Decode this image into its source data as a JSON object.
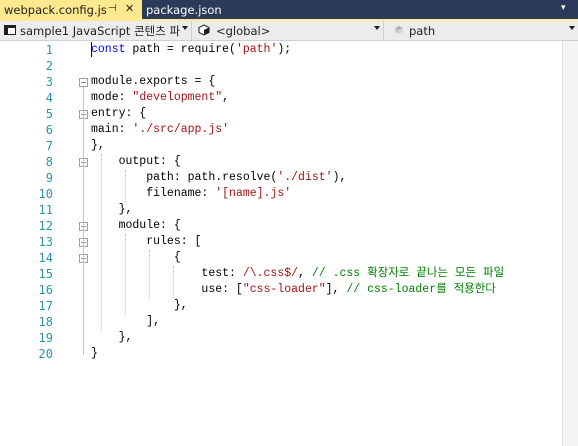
{
  "tabs": {
    "active": {
      "title": "webpack.config.js",
      "pin_glyph": "⊣",
      "close_glyph": "✕"
    },
    "inactive": {
      "title": "package.json"
    },
    "overflow_glyph": "▾"
  },
  "navbar": {
    "project": "sample1 JavaScript 콘텐츠 파",
    "scope": "<global>",
    "member": "path"
  },
  "colors": {
    "tab_active": "#ffe98f",
    "tabbar_bg": "#2b3a5a",
    "keyword": "#0000ff",
    "string": "#a31515",
    "comment": "#008000",
    "line_number": "#2b91af"
  },
  "editor": {
    "line_numbers": [
      "1",
      "2",
      "3",
      "4",
      "5",
      "6",
      "7",
      "8",
      "9",
      "10",
      "11",
      "12",
      "13",
      "14",
      "15",
      "16",
      "17",
      "18",
      "19",
      "20"
    ],
    "lines": [
      {
        "seg": [
          [
            "k",
            "const"
          ],
          [
            "t",
            " path = require("
          ],
          [
            "s",
            "'path'"
          ],
          [
            "t",
            ");"
          ]
        ]
      },
      {
        "seg": []
      },
      {
        "seg": [
          [
            "t",
            "module.exports = {"
          ]
        ]
      },
      {
        "seg": [
          [
            "t",
            "mode: "
          ],
          [
            "s",
            "\"development\""
          ],
          [
            "t",
            ","
          ]
        ]
      },
      {
        "seg": [
          [
            "t",
            "entry: {"
          ]
        ]
      },
      {
        "seg": [
          [
            "t",
            "main: "
          ],
          [
            "s",
            "'./src/app.js'"
          ]
        ]
      },
      {
        "seg": [
          [
            "t",
            "},"
          ]
        ]
      },
      {
        "seg": [
          [
            "t",
            "    output: {"
          ]
        ]
      },
      {
        "seg": [
          [
            "t",
            "        path: path.resolve("
          ],
          [
            "s",
            "'./dist'"
          ],
          [
            "t",
            "),"
          ]
        ]
      },
      {
        "seg": [
          [
            "t",
            "        filename: "
          ],
          [
            "s",
            "'[name].js'"
          ]
        ]
      },
      {
        "seg": [
          [
            "t",
            "    },"
          ]
        ]
      },
      {
        "seg": [
          [
            "t",
            "    module: {"
          ]
        ]
      },
      {
        "seg": [
          [
            "t",
            "        rules: ["
          ]
        ]
      },
      {
        "seg": [
          [
            "t",
            "            {"
          ]
        ]
      },
      {
        "seg": [
          [
            "t",
            "                test: "
          ],
          [
            "s",
            "/\\.css$/"
          ],
          [
            "t",
            ", "
          ],
          [
            "c",
            "// .css 확장자로 끝나는 모든 파일"
          ]
        ]
      },
      {
        "seg": [
          [
            "t",
            "                use: ["
          ],
          [
            "s",
            "\"css-loader\""
          ],
          [
            "t",
            "], "
          ],
          [
            "c",
            "// css-loader를 적용한다"
          ]
        ]
      },
      {
        "seg": [
          [
            "t",
            "            },"
          ]
        ]
      },
      {
        "seg": [
          [
            "t",
            "        ],"
          ]
        ]
      },
      {
        "seg": [
          [
            "t",
            "    },"
          ]
        ]
      },
      {
        "seg": [
          [
            "t",
            "}"
          ]
        ]
      }
    ]
  }
}
